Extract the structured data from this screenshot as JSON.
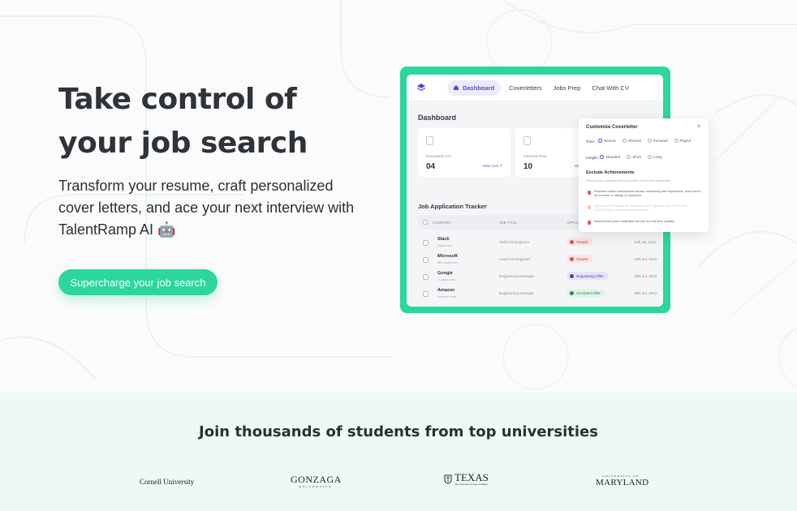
{
  "hero": {
    "title_line1": "Take control of",
    "title_line2": "your job search",
    "subtitle": "Transform your resume, craft personalized cover letters, and ace your next interview with TalentRamp AI 🤖",
    "cta_label": "Supercharge your job search"
  },
  "mockup": {
    "nav": {
      "logo_icon": "layers-icon",
      "items": [
        {
          "label": "Dashboard",
          "icon": "home-icon",
          "active": true
        },
        {
          "label": "Coverletters"
        },
        {
          "label": "Jobs Prep"
        },
        {
          "label": "Chat With CV"
        }
      ]
    },
    "dashboard_title": "Dashboard",
    "cards": [
      {
        "icon": "document-icon",
        "label": "Generated CVs",
        "value": "04",
        "link": "View CVs"
      },
      {
        "icon": "document-icon",
        "label": "Interview Prep",
        "value": "10",
        "link": "View"
      }
    ],
    "tracker": {
      "title": "Job Application Tracker",
      "columns": [
        "COMPANY",
        "JOB TITLE",
        "APPLICATION",
        "DATE"
      ],
      "rows": [
        {
          "company": "Slack",
          "sub": "slack.com",
          "title": "Staff iOS Engineer",
          "status": "Closed",
          "date": "11th Jul, 2022"
        },
        {
          "company": "Microsoft",
          "sub": "Microsoft.com",
          "title": "Lead iOS Engineer",
          "status": "Closed",
          "date": "12th Jul, 2023"
        },
        {
          "company": "Google",
          "sub": "Google.com",
          "title": "Engineering Manager",
          "status": "Negotiating Offer",
          "date": "20th Jul, 2023"
        },
        {
          "company": "Amazon",
          "sub": "Amazon.com",
          "title": "Engineering Manager",
          "status": "Accepted Offer",
          "date": "28th Jul, 2023"
        }
      ]
    },
    "status_colors": {
      "closed_bg": "#fbe3e3",
      "closed_dot": "#d9534f",
      "negotiating_bg": "#e6e4f8",
      "negotiating_dot": "#4a3fb8",
      "accepted_bg": "#dff3e6",
      "accepted_dot": "#2e8b57"
    }
  },
  "popup": {
    "title": "Customize Coverletter",
    "close_icon": "close-icon",
    "tone_label": "Tone:",
    "tone_options": [
      "Neutral",
      "Informal",
      "Personal",
      "Playful"
    ],
    "length_label": "Length:",
    "length_options": [
      "Standard",
      "Short",
      "Long"
    ],
    "exclude_title": "Exclude Achievements",
    "exclude_desc": "Remove any achievement to exclude it from the coverletter",
    "achievements": [
      "Resolved critical performance issues, enhancing user experience, which led to an increase in ratings on AppStore.",
      "Led a team to migrate the codebase from Objective-C to Swift in the AVP(MVVM) cross platform architecture.",
      "Implemented push notification service for real time updates."
    ]
  },
  "universities": {
    "title": "Join thousands of students from top universities",
    "logos": [
      {
        "name": "Cornell University"
      },
      {
        "name": "GONZAGA",
        "sub": "UNIVERSITY"
      },
      {
        "name": "TEXAS",
        "sub": "The University of Texas at Austin",
        "icon": "shield-icon"
      },
      {
        "name": "MARYLAND",
        "sub": "UNIVERSITY OF"
      }
    ]
  },
  "colors": {
    "accent": "#2dd69a",
    "brand_purple": "#5648d8",
    "uni_bg": "#edf9f4"
  }
}
